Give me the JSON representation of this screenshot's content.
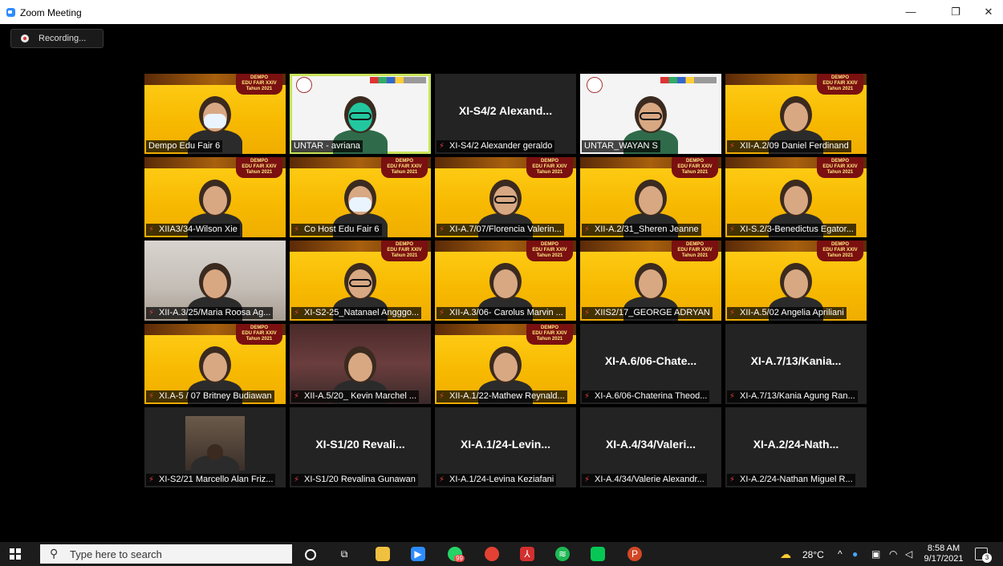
{
  "window": {
    "title": "Zoom Meeting",
    "minimize_glyph": "—",
    "maximize_glyph": "❐",
    "close_glyph": "✕"
  },
  "recording": {
    "label": "Recording..."
  },
  "tiles": [
    {
      "label": "Dempo Edu Fair 6",
      "muted": false,
      "style": "yellow"
    },
    {
      "label": "UNTAR - avriana",
      "muted": false,
      "style": "white",
      "active": true
    },
    {
      "label": "XI-S4/2 Alexander geraldo",
      "muted": true,
      "style": "dark",
      "big_name": "XI-S4/2  Alexand..."
    },
    {
      "label": "UNTAR_WAYAN S",
      "muted": false,
      "style": "white"
    },
    {
      "label": "XII-A.2/09 Daniel Ferdinand",
      "muted": true,
      "style": "yellow"
    },
    {
      "label": "XIIA3/34-Wilson Xie",
      "muted": true,
      "style": "yellow"
    },
    {
      "label": "Co Host Edu Fair 6",
      "muted": true,
      "style": "yellow"
    },
    {
      "label": "XI-A.7/07/Florencia Valerin...",
      "muted": true,
      "style": "yellow"
    },
    {
      "label": "XII-A.2/31_Sheren Jeanne",
      "muted": true,
      "style": "yellow"
    },
    {
      "label": "XI-S.2/3-Benedictus Egator...",
      "muted": true,
      "style": "yellow"
    },
    {
      "label": "XII-A.3/25/Maria Roosa Ag...",
      "muted": true,
      "style": "photo"
    },
    {
      "label": "XI-S2-25_Natanael Angggo...",
      "muted": true,
      "style": "yellow"
    },
    {
      "label": "XII-A.3/06- Carolus Marvin ...",
      "muted": true,
      "style": "yellow"
    },
    {
      "label": "XIIS2/17_GEORGE ADRYAN",
      "muted": true,
      "style": "yellow"
    },
    {
      "label": "XII-A.5/02 Angelia Apriliani",
      "muted": true,
      "style": "yellow"
    },
    {
      "label": "XI.A-5 / 07 Britney Budiawan",
      "muted": true,
      "style": "yellow"
    },
    {
      "label": "XII-A.5/20_ Kevin Marchel ...",
      "muted": true,
      "style": "darkroom"
    },
    {
      "label": "XII-A.1/22-Mathew Reynald...",
      "muted": true,
      "style": "yellow"
    },
    {
      "label": "XI-A.6/06-Chaterina Theod...",
      "muted": true,
      "style": "dark",
      "big_name": "XI-A.6/06-Chate..."
    },
    {
      "label": "XI-A.7/13/Kania Agung Ran...",
      "muted": true,
      "style": "dark",
      "big_name": "XI-A.7/13/Kania..."
    },
    {
      "label": "XI-S2/21 Marcello Alan Friz...",
      "muted": true,
      "style": "dark"
    },
    {
      "label": "XI-S1/20 Revalina Gunawan",
      "muted": true,
      "style": "dark",
      "big_name": "XI-S1/20  Revali..."
    },
    {
      "label": "XI-A.1/24-Levina Keziafani",
      "muted": true,
      "style": "dark",
      "big_name": "XI-A.1/24-Levin..."
    },
    {
      "label": "XI-A.4/34/Valerie Alexandr...",
      "muted": true,
      "style": "dark",
      "big_name": "XI-A.4/34/Valeri..."
    },
    {
      "label": "XI-A.2/24-Nathan Miguel R...",
      "muted": true,
      "style": "dark",
      "big_name": "XI-A.2/24-Nath..."
    }
  ],
  "banner": {
    "line1": "DEMPO",
    "line2": "EDU FAIR XXIV",
    "line3": "Tahun 2021"
  },
  "taskbar": {
    "search_placeholder": "Type here to search",
    "search_icon": "search-icon",
    "weather": "28°C",
    "time": "8:58 AM",
    "date": "9/17/2021",
    "notification_count": "3",
    "whatsapp_badge": "99"
  }
}
